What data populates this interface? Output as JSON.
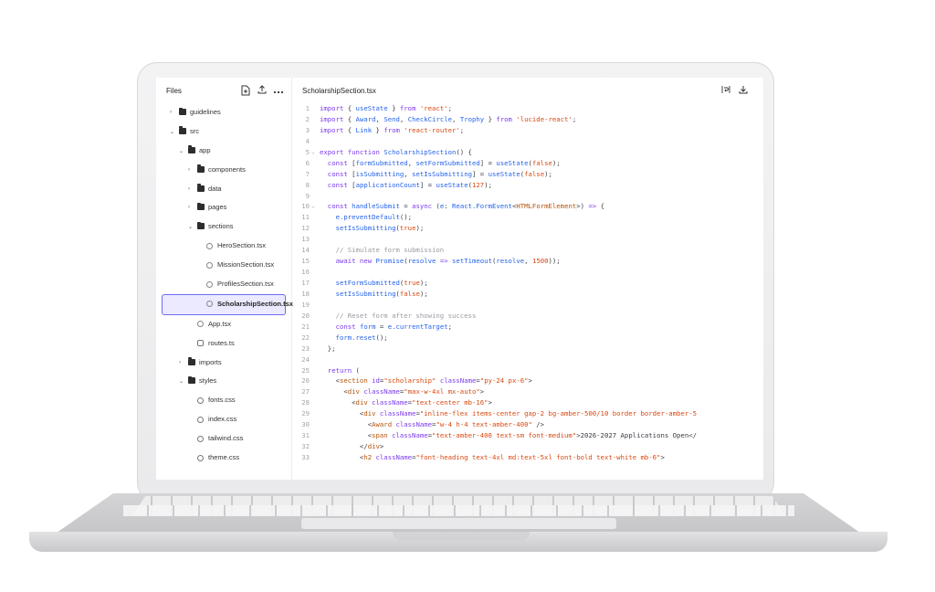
{
  "files": {
    "title": "Files",
    "tree": [
      {
        "label": "guidelines",
        "type": "folder",
        "depth": 0,
        "open": false
      },
      {
        "label": "src",
        "type": "folder",
        "depth": 0,
        "open": true
      },
      {
        "label": "app",
        "type": "folder",
        "depth": 1,
        "open": true
      },
      {
        "label": "components",
        "type": "folder",
        "depth": 2,
        "open": false
      },
      {
        "label": "data",
        "type": "folder",
        "depth": 2,
        "open": false
      },
      {
        "label": "pages",
        "type": "folder",
        "depth": 2,
        "open": false
      },
      {
        "label": "sections",
        "type": "folder",
        "depth": 2,
        "open": true
      },
      {
        "label": "HeroSection.tsx",
        "type": "component",
        "depth": 3
      },
      {
        "label": "MissionSection.tsx",
        "type": "component",
        "depth": 3
      },
      {
        "label": "ProfilesSection.tsx",
        "type": "component",
        "depth": 3
      },
      {
        "label": "ScholarshipSection.tsx",
        "type": "component",
        "depth": 3,
        "selected": true
      },
      {
        "label": "App.tsx",
        "type": "component",
        "depth": 2
      },
      {
        "label": "routes.ts",
        "type": "file",
        "depth": 2
      },
      {
        "label": "imports",
        "type": "folder",
        "depth": 1,
        "open": false
      },
      {
        "label": "styles",
        "type": "folder",
        "depth": 1,
        "open": true
      },
      {
        "label": "fonts.css",
        "type": "css",
        "depth": 2
      },
      {
        "label": "index.css",
        "type": "css",
        "depth": 2
      },
      {
        "label": "tailwind.css",
        "type": "css",
        "depth": 2
      },
      {
        "label": "theme.css",
        "type": "css",
        "depth": 2
      }
    ]
  },
  "editor": {
    "filename": "ScholarshipSection.tsx",
    "lines": [
      [
        [
          "k",
          "import"
        ],
        [
          "p",
          " { "
        ],
        [
          "f",
          "useState"
        ],
        [
          "p",
          " } "
        ],
        [
          "k",
          "from"
        ],
        [
          "s",
          " 'react'"
        ],
        [
          "p",
          ";"
        ]
      ],
      [
        [
          "k",
          "import"
        ],
        [
          "p",
          " { "
        ],
        [
          "f",
          "Award"
        ],
        [
          "p",
          ", "
        ],
        [
          "f",
          "Send"
        ],
        [
          "p",
          ", "
        ],
        [
          "f",
          "CheckCircle"
        ],
        [
          "p",
          ", "
        ],
        [
          "f",
          "Trophy"
        ],
        [
          "p",
          " } "
        ],
        [
          "k",
          "from"
        ],
        [
          "s",
          " 'lucide-react'"
        ],
        [
          "p",
          ";"
        ]
      ],
      [
        [
          "k",
          "import"
        ],
        [
          "p",
          " { "
        ],
        [
          "f",
          "Link"
        ],
        [
          "p",
          " } "
        ],
        [
          "k",
          "from"
        ],
        [
          "s",
          " 'react-router'"
        ],
        [
          "p",
          ";"
        ]
      ],
      [],
      [
        [
          "k",
          "export function "
        ],
        [
          "f",
          "ScholarshipSection"
        ],
        [
          "p",
          "() {"
        ]
      ],
      [
        [
          "p",
          "  "
        ],
        [
          "k",
          "const"
        ],
        [
          "p",
          " ["
        ],
        [
          "f",
          "formSubmitted"
        ],
        [
          "p",
          ", "
        ],
        [
          "f",
          "setFormSubmitted"
        ],
        [
          "p",
          "] = "
        ],
        [
          "f",
          "useState"
        ],
        [
          "p",
          "("
        ],
        [
          "s",
          "false"
        ],
        [
          "p",
          ");"
        ]
      ],
      [
        [
          "p",
          "  "
        ],
        [
          "k",
          "const"
        ],
        [
          "p",
          " ["
        ],
        [
          "f",
          "isSubmitting"
        ],
        [
          "p",
          ", "
        ],
        [
          "f",
          "setIsSubmitting"
        ],
        [
          "p",
          "] = "
        ],
        [
          "f",
          "useState"
        ],
        [
          "p",
          "("
        ],
        [
          "s",
          "false"
        ],
        [
          "p",
          ");"
        ]
      ],
      [
        [
          "p",
          "  "
        ],
        [
          "k",
          "const"
        ],
        [
          "p",
          " ["
        ],
        [
          "f",
          "applicationCount"
        ],
        [
          "p",
          "] = "
        ],
        [
          "f",
          "useState"
        ],
        [
          "p",
          "("
        ],
        [
          "s",
          "127"
        ],
        [
          "p",
          ");"
        ]
      ],
      [],
      [
        [
          "p",
          "  "
        ],
        [
          "k",
          "const"
        ],
        [
          "p",
          " "
        ],
        [
          "f",
          "handleSubmit"
        ],
        [
          "p",
          " = "
        ],
        [
          "k",
          "async"
        ],
        [
          "p",
          " ("
        ],
        [
          "f",
          "e"
        ],
        [
          "p",
          ": "
        ],
        [
          "f",
          "React.FormEvent"
        ],
        [
          "p",
          "<"
        ],
        [
          "t",
          "HTMLFormElement"
        ],
        [
          "p",
          ">) "
        ],
        [
          "k",
          "=>"
        ],
        [
          "p",
          " {"
        ]
      ],
      [
        [
          "p",
          "    "
        ],
        [
          "f",
          "e.preventDefault"
        ],
        [
          "p",
          "();"
        ]
      ],
      [
        [
          "p",
          "    "
        ],
        [
          "f",
          "setIsSubmitting"
        ],
        [
          "p",
          "("
        ],
        [
          "s",
          "true"
        ],
        [
          "p",
          ");"
        ]
      ],
      [],
      [
        [
          "c",
          "    // Simulate form submission"
        ]
      ],
      [
        [
          "p",
          "    "
        ],
        [
          "k",
          "await new "
        ],
        [
          "f",
          "Promise"
        ],
        [
          "p",
          "("
        ],
        [
          "f",
          "resolve"
        ],
        [
          "k",
          " => "
        ],
        [
          "f",
          "setTimeout"
        ],
        [
          "p",
          "("
        ],
        [
          "f",
          "resolve"
        ],
        [
          "p",
          ", "
        ],
        [
          "s",
          "1500"
        ],
        [
          "p",
          "));"
        ]
      ],
      [],
      [
        [
          "p",
          "    "
        ],
        [
          "f",
          "setFormSubmitted"
        ],
        [
          "p",
          "("
        ],
        [
          "s",
          "true"
        ],
        [
          "p",
          ");"
        ]
      ],
      [
        [
          "p",
          "    "
        ],
        [
          "f",
          "setIsSubmitting"
        ],
        [
          "p",
          "("
        ],
        [
          "s",
          "false"
        ],
        [
          "p",
          ");"
        ]
      ],
      [],
      [
        [
          "c",
          "    // Reset form after showing success"
        ]
      ],
      [
        [
          "p",
          "    "
        ],
        [
          "k",
          "const"
        ],
        [
          "p",
          " "
        ],
        [
          "f",
          "form"
        ],
        [
          "p",
          " = "
        ],
        [
          "f",
          "e.currentTarget"
        ],
        [
          "p",
          ";"
        ]
      ],
      [
        [
          "p",
          "    "
        ],
        [
          "f",
          "form.reset"
        ],
        [
          "p",
          "();"
        ]
      ],
      [
        [
          "p",
          "  };"
        ]
      ],
      [],
      [
        [
          "p",
          "  "
        ],
        [
          "k",
          "return"
        ],
        [
          "p",
          " ("
        ]
      ],
      [
        [
          "p",
          "    <"
        ],
        [
          "t",
          "section"
        ],
        [
          "a",
          " id"
        ],
        [
          "p",
          "="
        ],
        [
          "s",
          "\"scholarship\""
        ],
        [
          "a",
          " className"
        ],
        [
          "p",
          "="
        ],
        [
          "s",
          "\"py-24 px-6\""
        ],
        [
          "p",
          ">"
        ]
      ],
      [
        [
          "p",
          "      <"
        ],
        [
          "t",
          "div"
        ],
        [
          "a",
          " className"
        ],
        [
          "p",
          "="
        ],
        [
          "s",
          "\"max-w-4xl mx-auto\""
        ],
        [
          "p",
          ">"
        ]
      ],
      [
        [
          "p",
          "        <"
        ],
        [
          "t",
          "div"
        ],
        [
          "a",
          " className"
        ],
        [
          "p",
          "="
        ],
        [
          "s",
          "\"text-center mb-16\""
        ],
        [
          "p",
          ">"
        ]
      ],
      [
        [
          "p",
          "          <"
        ],
        [
          "t",
          "div"
        ],
        [
          "a",
          " className"
        ],
        [
          "p",
          "="
        ],
        [
          "s",
          "\"inline-flex items-center gap-2 bg-amber-500/10 border border-amber-5"
        ]
      ],
      [
        [
          "p",
          "            <"
        ],
        [
          "t",
          "Award"
        ],
        [
          "a",
          " className"
        ],
        [
          "p",
          "="
        ],
        [
          "s",
          "\"w-4 h-4 text-amber-400\""
        ],
        [
          "p",
          " />"
        ]
      ],
      [
        [
          "p",
          "            <"
        ],
        [
          "t",
          "span"
        ],
        [
          "a",
          " className"
        ],
        [
          "p",
          "="
        ],
        [
          "s",
          "\"text-amber-400 text-sm font-medium\""
        ],
        [
          "p",
          ">2026-2027 Applications Open</"
        ]
      ],
      [
        [
          "p",
          "          </"
        ],
        [
          "t",
          "div"
        ],
        [
          "p",
          ">"
        ]
      ],
      [
        [
          "p",
          "          <"
        ],
        [
          "t",
          "h2"
        ],
        [
          "a",
          " className"
        ],
        [
          "p",
          "="
        ],
        [
          "s",
          "\"font-heading text-4xl md:text-5xl font-bold text-white mb-6\""
        ],
        [
          "p",
          ">"
        ]
      ]
    ]
  },
  "icons": {
    "new_file": "file-plus-icon",
    "upload": "upload-icon",
    "more": "more-horizontal-icon",
    "wrap": "text-wrap-icon",
    "download": "download-icon"
  }
}
